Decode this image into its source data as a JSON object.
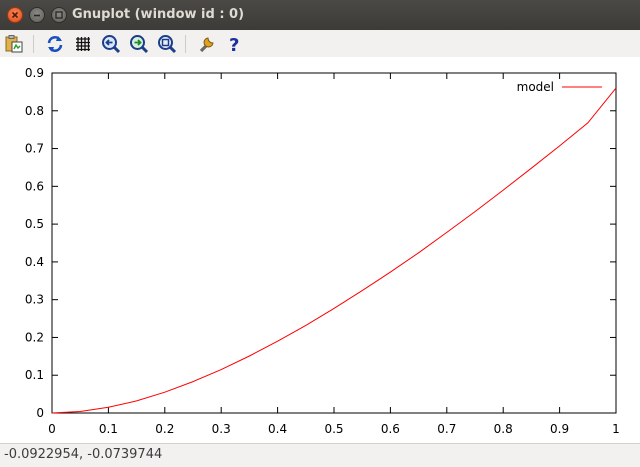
{
  "window": {
    "title": "Gnuplot (window id : 0)"
  },
  "toolbar": {
    "buttons": [
      "copy-to-clipboard-icon",
      "replot-icon",
      "grid-icon",
      "zoom-previous-icon",
      "zoom-next-icon",
      "unzoom-icon",
      "preferences-icon",
      "help-icon"
    ]
  },
  "status": {
    "coords": "-0.0922954, -0.0739744"
  },
  "colors": {
    "series": "#ff0000",
    "titlebar": "#3c3b37"
  },
  "chart_data": {
    "type": "line",
    "title": "",
    "xlabel": "",
    "ylabel": "",
    "xlim": [
      0,
      1
    ],
    "ylim": [
      0,
      0.9
    ],
    "xticks": [
      "0",
      "0.1",
      "0.2",
      "0.3",
      "0.4",
      "0.5",
      "0.6",
      "0.7",
      "0.8",
      "0.9",
      "1"
    ],
    "yticks": [
      "0",
      "0.1",
      "0.2",
      "0.3",
      "0.4",
      "0.5",
      "0.6",
      "0.7",
      "0.8",
      "0.9"
    ],
    "grid": false,
    "legend_position": "top-right",
    "series": [
      {
        "name": "model",
        "x": [
          0,
          0.05,
          0.1,
          0.15,
          0.2,
          0.25,
          0.3,
          0.35,
          0.4,
          0.45,
          0.5,
          0.55,
          0.6,
          0.65,
          0.7,
          0.75,
          0.8,
          0.85,
          0.9,
          0.95,
          1
        ],
        "y": [
          0,
          0.004,
          0.015,
          0.032,
          0.055,
          0.083,
          0.115,
          0.151,
          0.19,
          0.232,
          0.277,
          0.324,
          0.373,
          0.424,
          0.478,
          0.533,
          0.59,
          0.648,
          0.707,
          0.768,
          0.86
        ]
      }
    ]
  }
}
